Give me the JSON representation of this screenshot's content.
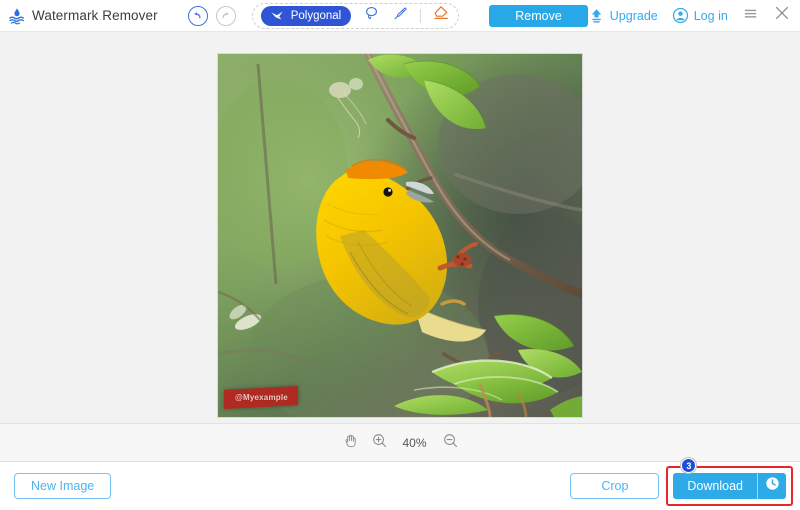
{
  "app": {
    "title": "Watermark Remover",
    "logo_icon": "water-drop-waves-logo"
  },
  "toolbar": {
    "undo_icon": "undo-arrow-icon",
    "redo_icon": "redo-arrow-icon",
    "active_tool_label": "Polygonal",
    "active_tool_icon": "polygonal-lasso-icon",
    "tools": [
      {
        "name": "lasso",
        "icon": "lasso-icon"
      },
      {
        "name": "brush",
        "icon": "brush-icon"
      },
      {
        "name": "eraser",
        "icon": "eraser-icon"
      }
    ],
    "remove_label": "Remove",
    "upgrade_label": "Upgrade",
    "upgrade_icon": "upload-upgrade-icon",
    "login_label": "Log in",
    "login_icon": "user-circle-icon",
    "menu_icon": "hamburger-menu-icon",
    "close_icon": "close-icon"
  },
  "canvas": {
    "image_alt": "yellow-weaver-bird-on-branch",
    "watermark_text": "@Myexample"
  },
  "zoombar": {
    "hand_icon": "hand-pan-icon",
    "zoom_in_icon": "zoom-in-icon",
    "zoom_level": "40%",
    "zoom_out_icon": "zoom-out-icon"
  },
  "bottombar": {
    "new_image_label": "New Image",
    "crop_label": "Crop",
    "download_label": "Download",
    "download_history_icon": "history-clock-icon",
    "step_badge": "3"
  },
  "colors": {
    "primary_blue": "#29a8e8",
    "tool_blue": "#2f55d4",
    "link_blue": "#33aaee",
    "eraser_orange": "#e8742a",
    "highlight_red": "#e8262a",
    "badge_blue": "#1b4fd8",
    "watermark_red": "#b02a21"
  }
}
